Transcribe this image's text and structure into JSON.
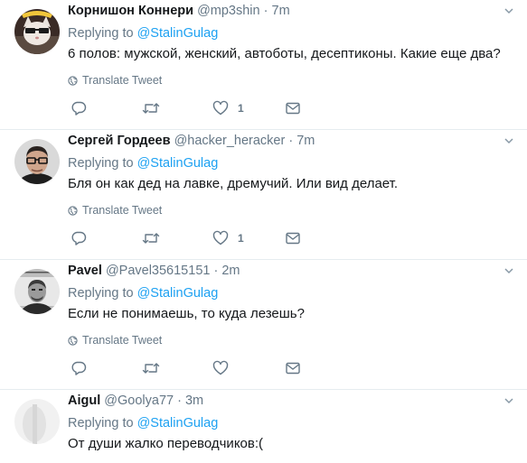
{
  "tweets": [
    {
      "name": "Корнишон Коннери",
      "handle": "@mp3shin",
      "sep": "·",
      "time": "7m",
      "replying_prefix": "Replying to",
      "replying_handle": "@StalinGulag",
      "text": "6 полов: мужской, женский, автоботы, десептиконы. Какие еще два?",
      "translate_label": "Translate Tweet",
      "like_count": "1",
      "avatar_icon": "cat-avatar-icon"
    },
    {
      "name": "Сергей Гордеев",
      "handle": "@hacker_heracker",
      "sep": "·",
      "time": "7m",
      "replying_prefix": "Replying to",
      "replying_handle": "@StalinGulag",
      "text": "Бля он как дед на лавке, дремучий. Или вид делает.",
      "translate_label": "Translate Tweet",
      "like_count": "1",
      "avatar_icon": "man-glasses-avatar-icon"
    },
    {
      "name": "Pavel",
      "handle": "@Pavel35615151",
      "sep": "·",
      "time": "2m",
      "replying_prefix": "Replying to",
      "replying_handle": "@StalinGulag",
      "text": "Если не понимаешь, то куда лезешь?",
      "translate_label": "Translate Tweet",
      "like_count": "",
      "avatar_icon": "portrait-avatar-icon"
    },
    {
      "name": "Aigul",
      "handle": "@Goolya77",
      "sep": "·",
      "time": "3m",
      "replying_prefix": "Replying to",
      "replying_handle": "@StalinGulag",
      "text": "От души жалко переводчиков:(",
      "avatar_icon": "light-avatar-icon"
    }
  ],
  "colors": {
    "text": "#14171a",
    "muted": "#657786",
    "link": "#1da1f2",
    "divider": "#e6ecf0"
  }
}
